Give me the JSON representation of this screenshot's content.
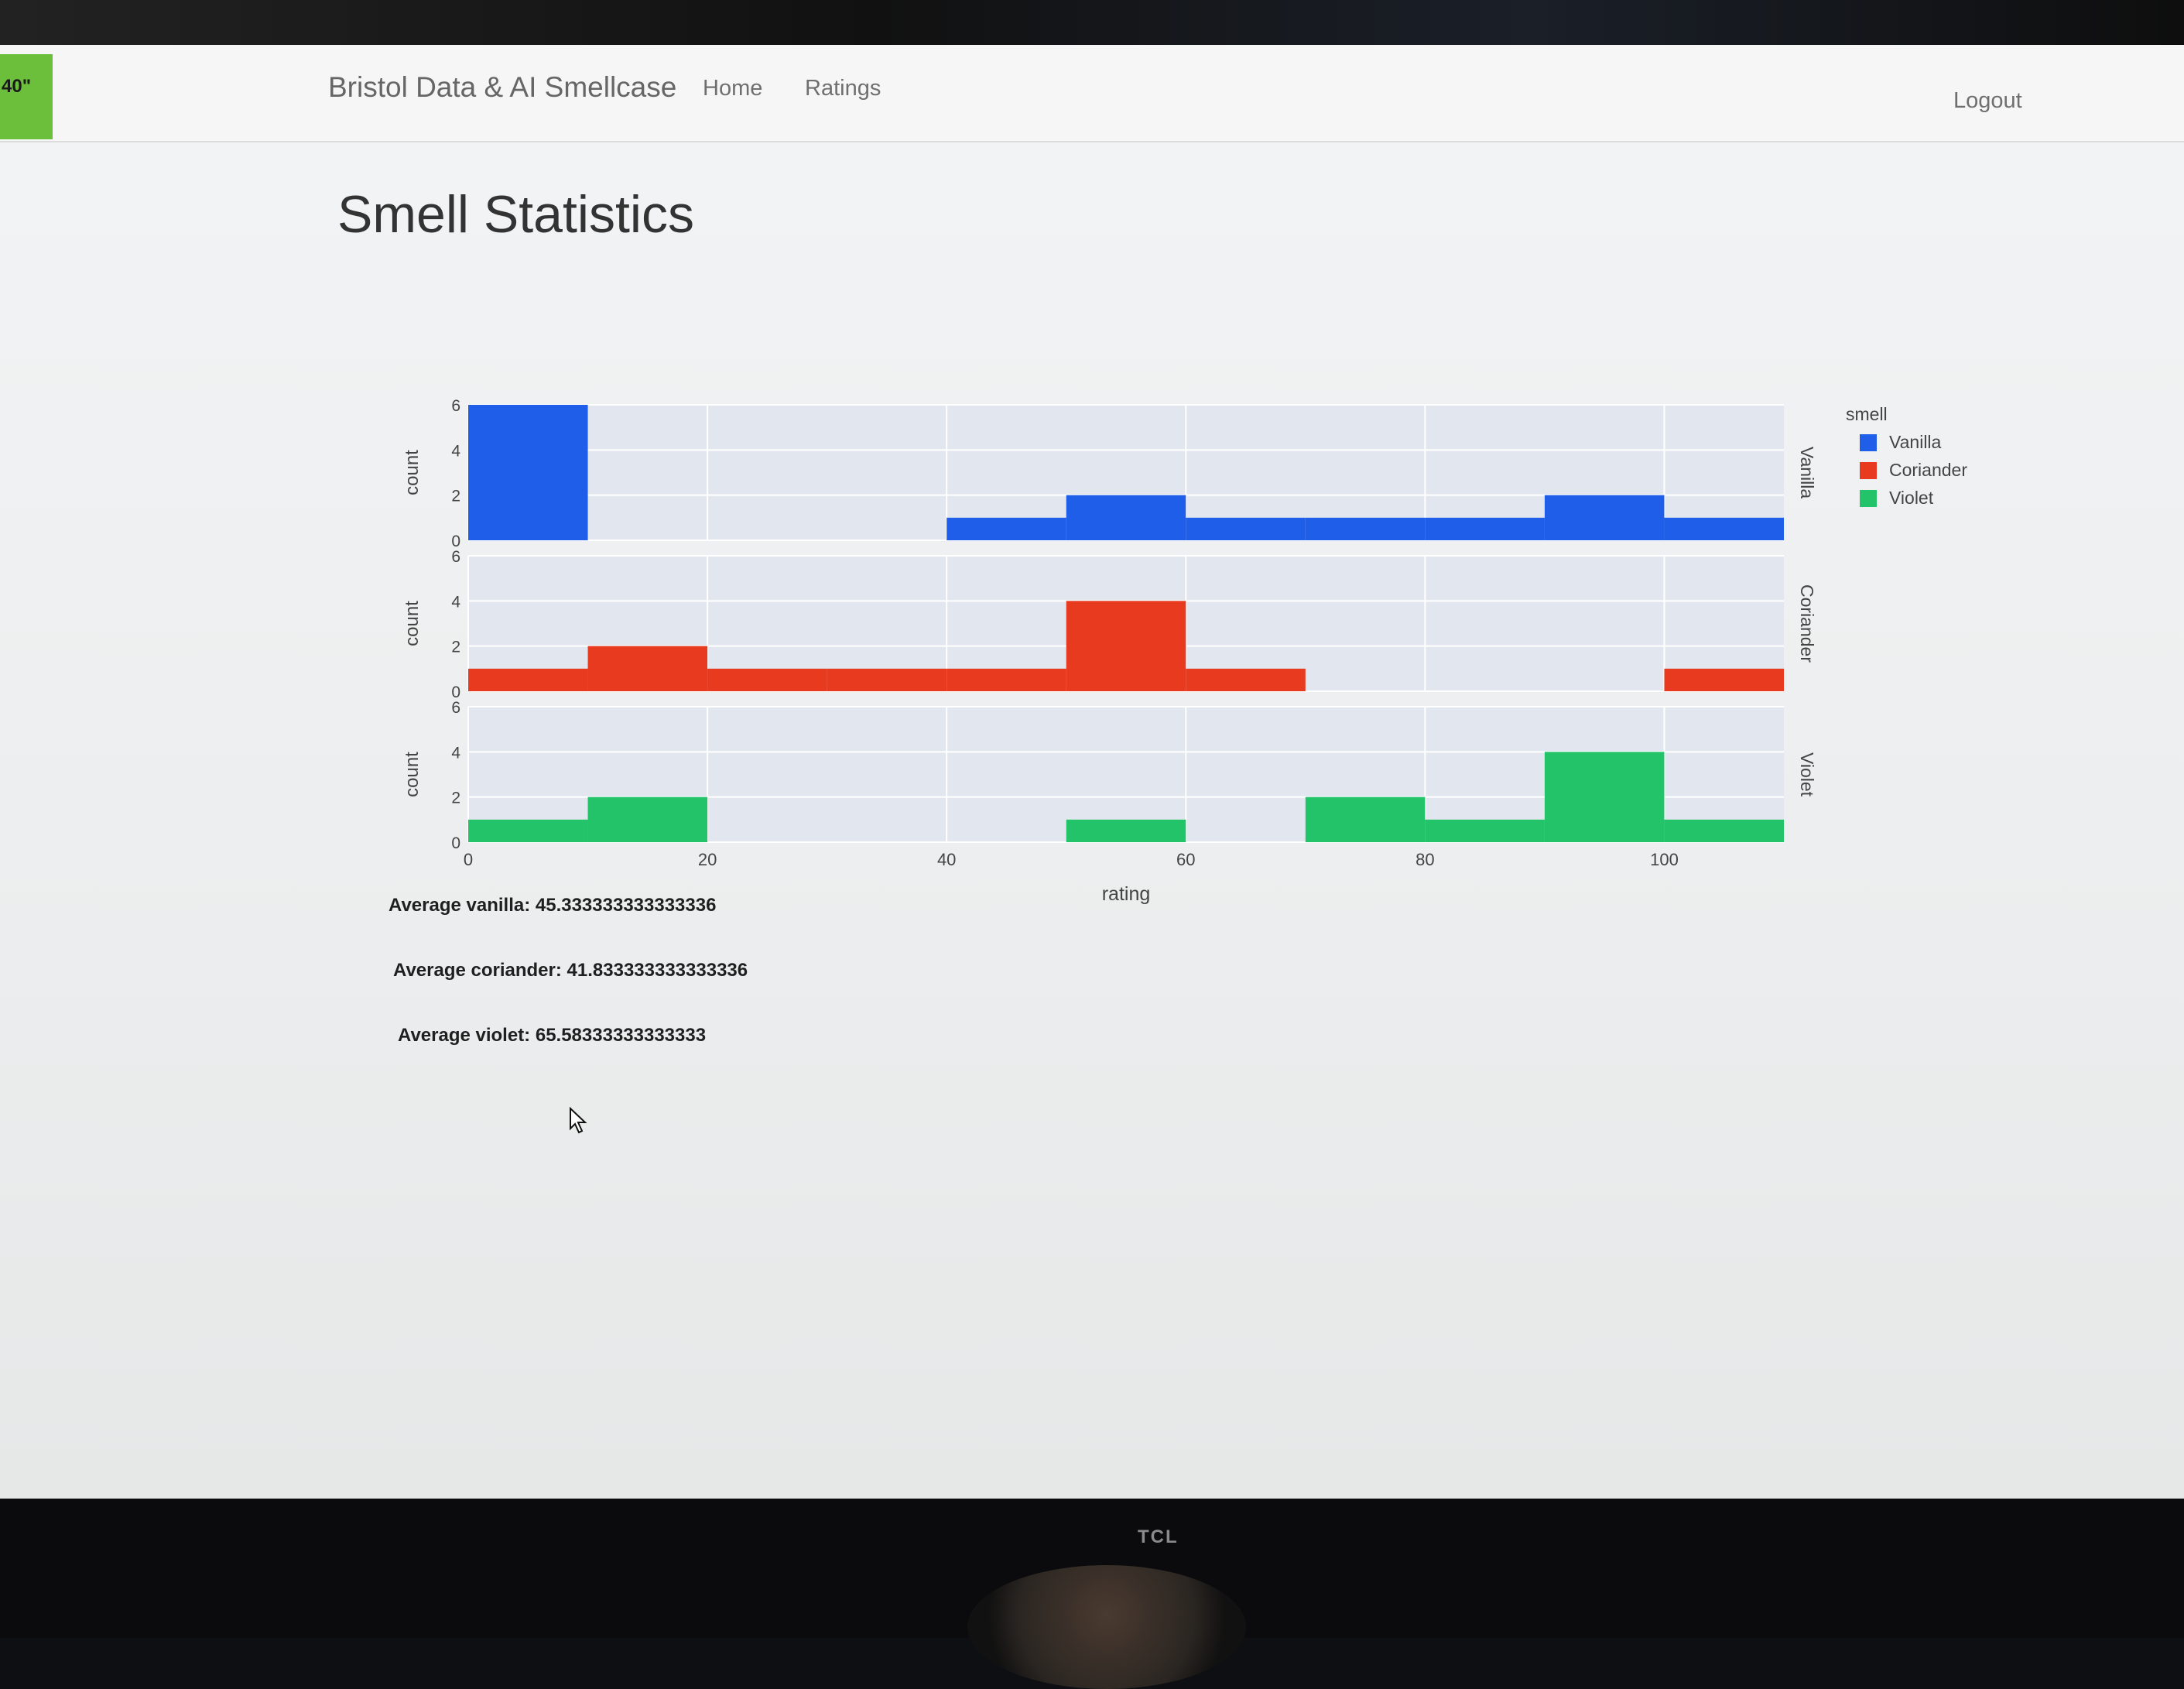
{
  "device": {
    "size_badge": "40\"",
    "brand": "TCL"
  },
  "navbar": {
    "brand": "Bristol Data & AI Smellcase",
    "home": "Home",
    "ratings": "Ratings",
    "logout": "Logout"
  },
  "page": {
    "title": "Smell Statistics"
  },
  "stats": {
    "vanilla": "Average vanilla: 45.333333333333336",
    "coriander": "Average coriander: 41.833333333333336",
    "violet": "Average violet: 65.58333333333333"
  },
  "colors": {
    "vanilla": "#1f5ee8",
    "coriander": "#e83a1e",
    "violet": "#23c36a",
    "plot_bg": "#e2e6ef",
    "grid": "#ffffff",
    "text": "#444444"
  },
  "chart_data": {
    "type": "bar",
    "xlabel": "rating",
    "ylabel": "count",
    "xlim": [
      0,
      110
    ],
    "ylim": [
      0,
      6
    ],
    "x_ticks": [
      0,
      20,
      40,
      60,
      80,
      100
    ],
    "y_ticks": [
      0,
      2,
      4,
      6
    ],
    "bin_edges": [
      0,
      10,
      20,
      30,
      40,
      50,
      60,
      70,
      80,
      90,
      100,
      110
    ],
    "legend_title": "smell",
    "legend_position": "top-right",
    "series": [
      {
        "name": "Vanilla",
        "values": [
          6,
          0,
          0,
          0,
          1,
          2,
          1,
          1,
          1,
          2,
          1
        ]
      },
      {
        "name": "Coriander",
        "values": [
          1,
          2,
          1,
          1,
          1,
          4,
          1,
          0,
          0,
          0,
          1
        ]
      },
      {
        "name": "Violet",
        "values": [
          1,
          2,
          0,
          0,
          0,
          1,
          0,
          2,
          1,
          4,
          1
        ]
      }
    ]
  }
}
